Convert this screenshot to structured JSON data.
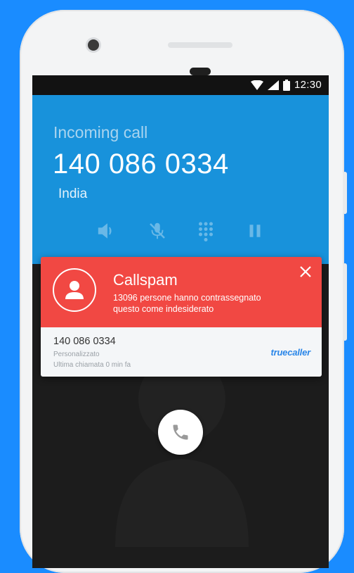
{
  "status_bar": {
    "time": "12:30",
    "icons": [
      "wifi-icon",
      "signal-icon",
      "battery-icon"
    ]
  },
  "call": {
    "incoming_label": "Incoming call",
    "number": "140 086 0334",
    "country": "India",
    "controls": [
      "speaker-icon",
      "mute-icon",
      "dialpad-icon",
      "pause-icon"
    ]
  },
  "spam_card": {
    "title": "Callspam",
    "description": "13096 persone hanno contrassegnato questo come indesiderato",
    "number": "140 086 0334",
    "label": "Personalizzato",
    "last_call": "Ultima chiamata 0 min fa",
    "brand": "truecaller"
  },
  "colors": {
    "background": "#1a8cff",
    "call_header": "#1892db",
    "spam_red": "#f14843",
    "brand_blue": "#2a86e8"
  }
}
